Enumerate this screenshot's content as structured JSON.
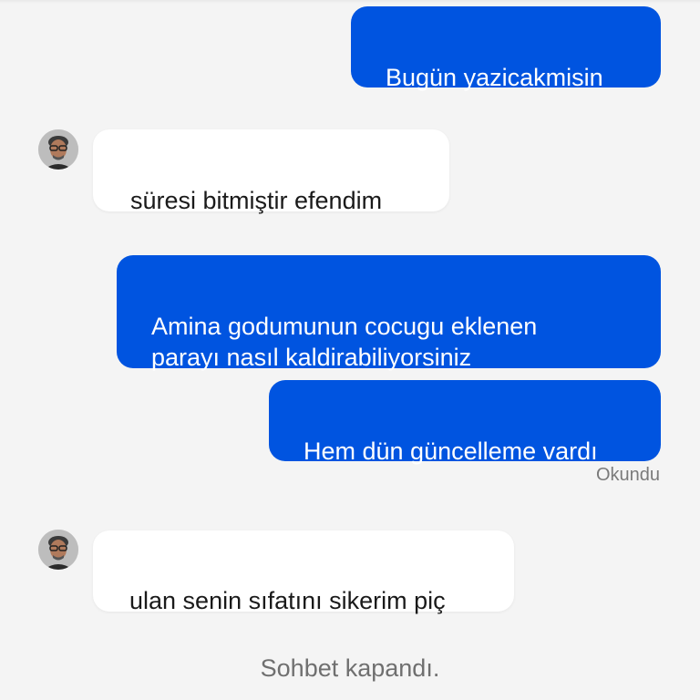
{
  "messages": [
    {
      "direction": "out",
      "text": "Bugün yazicakmisin"
    },
    {
      "direction": "in",
      "text": "süresi bitmiştir efendim"
    },
    {
      "direction": "out",
      "text": "Amina godumunun cocugu eklenen\nparayı nasıl kaldirabiliyorsiniz"
    },
    {
      "direction": "out",
      "text": "Hem dün güncelleme vardı"
    },
    {
      "direction": "in",
      "text": "ulan senin sıfatını sikerim piç"
    }
  ],
  "read_receipt": "Okundu",
  "closed_notice": "Sohbet kapandı.",
  "colors": {
    "outgoing_bubble": "#0054e0",
    "incoming_bubble": "#ffffff",
    "background": "#f4f4f4"
  }
}
